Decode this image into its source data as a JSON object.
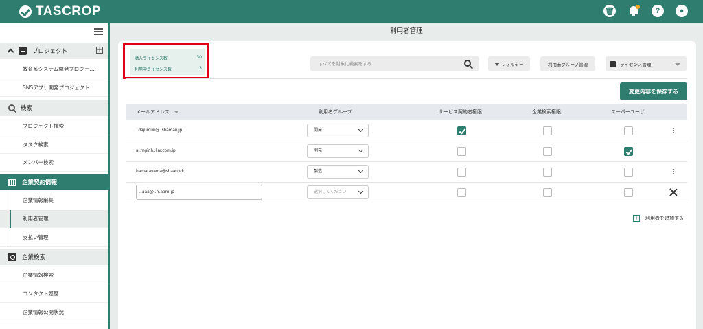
{
  "app": {
    "name": "TASCROP"
  },
  "header_icons": [
    "trash-icon",
    "bell-icon",
    "help-icon",
    "account-icon"
  ],
  "help_glyph": "?",
  "sidebar": {
    "project_section": "プロジェクト",
    "project_items": [
      "教育系システム開発プロジェ…",
      "SNSアプリ開発プロジェクト"
    ],
    "search_section": "検索",
    "search_items": [
      "プロジェクト検索",
      "タスク検索",
      "メンバー検索"
    ],
    "contract_section": "企業契約情報",
    "contract_items": [
      "企業情報編集",
      "利用者管理",
      "支払い管理"
    ],
    "company_search_section": "企業検索",
    "company_search_items": [
      "企業情報検索",
      "コンタクト履歴",
      "企業情報公開状況"
    ]
  },
  "page": {
    "title": "利用者管理"
  },
  "license": {
    "purchased_label": "購入ライセンス数",
    "purchased_value": "30",
    "in_use_label": "利用中ライセンス数",
    "in_use_value": "3"
  },
  "toolbar": {
    "search_placeholder": "すべてを対象に検索をする",
    "filter_label": "フィルター",
    "group_mgmt_label": "利用者グループ管理",
    "license_mgmt_label": "ライセンス管理",
    "save_label": "変更内容を保存する"
  },
  "table": {
    "headers": {
      "email": "メールアドレス",
      "group": "利用者グループ",
      "service_admin": "サービス契約者権限",
      "company_search": "企業検索権限",
      "superuser": "スーパーユーザ"
    },
    "rows": [
      {
        "email": "..dajumuu@..shamau.jp",
        "group": "開発",
        "service_admin": true,
        "company_search": false,
        "superuser": false
      },
      {
        "email": "a..mgirlh..l.ar.com.jp",
        "group": "開発",
        "service_admin": false,
        "company_search": false,
        "superuser": true
      },
      {
        "email": "hamaravama@shaaundr",
        "group": "製造",
        "service_admin": false,
        "company_search": false,
        "superuser": false
      },
      {
        "email": "..aaa@..h.aam.jp",
        "group": "選択してください",
        "service_admin": false,
        "company_search": false,
        "superuser": false
      }
    ]
  },
  "add_user_label": "利用者を追加する"
}
